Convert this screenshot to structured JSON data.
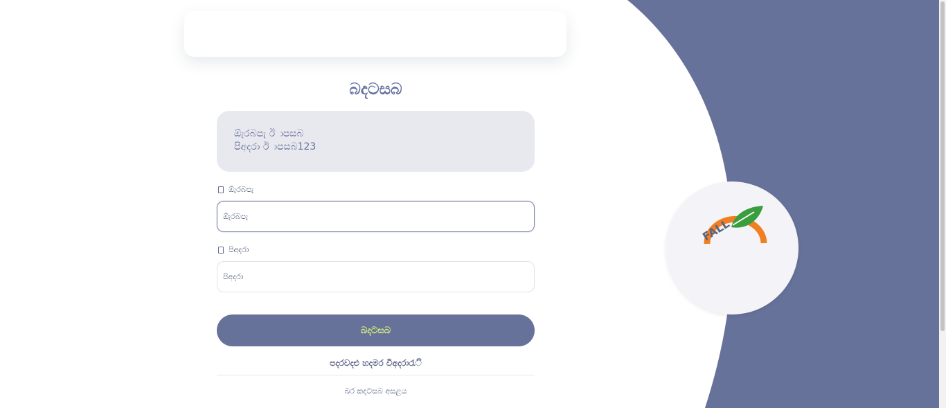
{
  "page": {
    "title": "බදටසබ"
  },
  "hint": {
    "line1": "ඕැරබපැ ඊ ාපසබ",
    "line2": "පිඅදරා ඊ ාපසබ123"
  },
  "username": {
    "label": "ඕැරබපැ",
    "placeholder": "ඕැරබපැ"
  },
  "password": {
    "label": "පිඅදරා",
    "placeholder": "පිඅදරා"
  },
  "submit_label": "බදටසබ",
  "forgot_label": "පදරවදළු හදමර විඅදරාරැි",
  "register_label": "ඛර කදටසබ අසළය",
  "logo": {
    "text": "FALL",
    "icon": "fruit-leaf-logo"
  },
  "colors": {
    "accent": "#667299",
    "button_text": "#dff57a",
    "logo_orange": "#f07f22",
    "logo_green": "#3a9e3f"
  }
}
